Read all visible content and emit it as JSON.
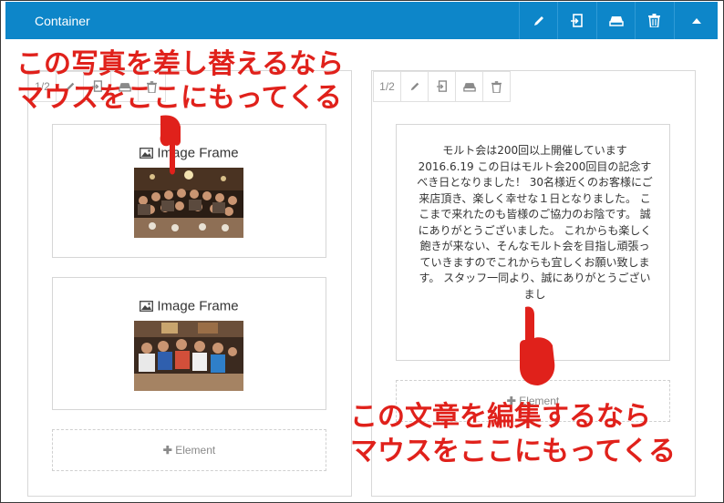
{
  "header": {
    "title": "Container",
    "buttons": [
      "pencil-icon",
      "import-icon",
      "eraser-icon",
      "trash-icon",
      "caret-up-icon"
    ],
    "accent": "#0d86c9"
  },
  "left_column": {
    "toolbar": {
      "ratio": "1/2"
    },
    "frames": [
      {
        "title": "Image Frame"
      },
      {
        "title": "Image Frame"
      }
    ],
    "add_element": "Element"
  },
  "right_column": {
    "toolbar": {
      "ratio": "1/2"
    },
    "text": "モルト会は200回以上開催しています 2016.6.19 この日はモルト会200回目の記念すべき日となりました！ 30名様近くのお客様にご来店頂き、楽しく幸せな１日となりました。 ここまで来れたのも皆様のご協力のお陰です。 誠にありがとうございました。 これからも楽しく飽きが来ない、そんなモルト会を目指し頑張っていきますのでこれからも宜しくお願い致します。 スタッフ一同より、誠にありがとうございまし",
    "add_element": "Element"
  },
  "annotations": {
    "top_line1": "この写真を差し替えるなら",
    "top_line2": "マウスをここにもってくる",
    "bottom_line1": "この文章を編集するなら",
    "bottom_line2": "マウスをここにもってくる",
    "color": "#e0211b"
  }
}
